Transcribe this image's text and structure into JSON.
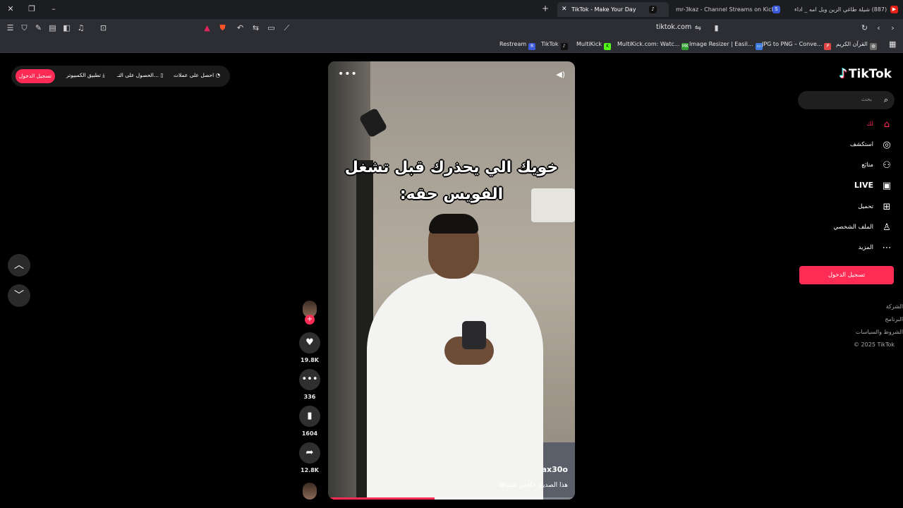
{
  "browser": {
    "tabs": [
      {
        "title": "(887) شيلة طاغي الزين ويل امه _ اداء"
      },
      {
        "title": "mr-3kaz - Channel Streams on Kick"
      },
      {
        "title": "TikTok - Make Your Day"
      }
    ],
    "url": "tiktok.com",
    "bookmarks": [
      {
        "label": "Restream",
        "icon": "R",
        "color": "#3f5bd9"
      },
      {
        "label": "TikTok",
        "icon": "♪",
        "color": "#111111"
      },
      {
        "label": "MultiKick",
        "icon": "K",
        "color": "#53fc18"
      },
      {
        "label": "MultiKick.com: Watc...",
        "icon": "MK",
        "color": "#2f9e2f"
      },
      {
        "label": "Image Resizer | Easil...",
        "icon": "▭",
        "color": "#3d7be0"
      },
      {
        "label": "JPG to PNG – Conve...",
        "icon": "P",
        "color": "#e04646"
      },
      {
        "label": "القرآن الكريم",
        "icon": "◍",
        "color": "#6b6b6b"
      }
    ]
  },
  "topbar": {
    "login_label": "تسجيل الدخول",
    "desktop_app": "تطبيق الكمبيوتر",
    "get_app": "الحصول على التـ...",
    "get_coins": "احصل على عملات"
  },
  "video": {
    "caption_line1": "خويك الي يحذرك قبل تشغل",
    "caption_line2": "الفويس حقه:",
    "handle": "ax30o",
    "description": "هذا الصديق حافض عليه😂",
    "progress": 0.43
  },
  "actions": {
    "likes": "19.8K",
    "comments": "336",
    "saves": "1604",
    "shares": "12.8K"
  },
  "sidebar": {
    "brand": "TikTok",
    "search_placeholder": "بحث",
    "items": [
      {
        "label": "لك",
        "icon": "home-icon",
        "glyph": "⌂"
      },
      {
        "label": "استكشف",
        "icon": "compass-icon",
        "glyph": "◎"
      },
      {
        "label": "متابَع",
        "icon": "following-icon",
        "glyph": "⚇"
      },
      {
        "label": "LIVE",
        "icon": "live-icon",
        "glyph": "▣"
      },
      {
        "label": "تحميل",
        "icon": "upload-icon",
        "glyph": "⊞"
      },
      {
        "label": "الملف الشخصي",
        "icon": "profile-icon",
        "glyph": "♙"
      },
      {
        "label": "المزيد",
        "icon": "more-icon",
        "glyph": "⋯"
      }
    ],
    "login_button": "تسجيل الدخول",
    "footer": [
      "الشركة",
      "البرنامج",
      "الشروط والسياسات",
      "© 2025 TikTok"
    ]
  }
}
